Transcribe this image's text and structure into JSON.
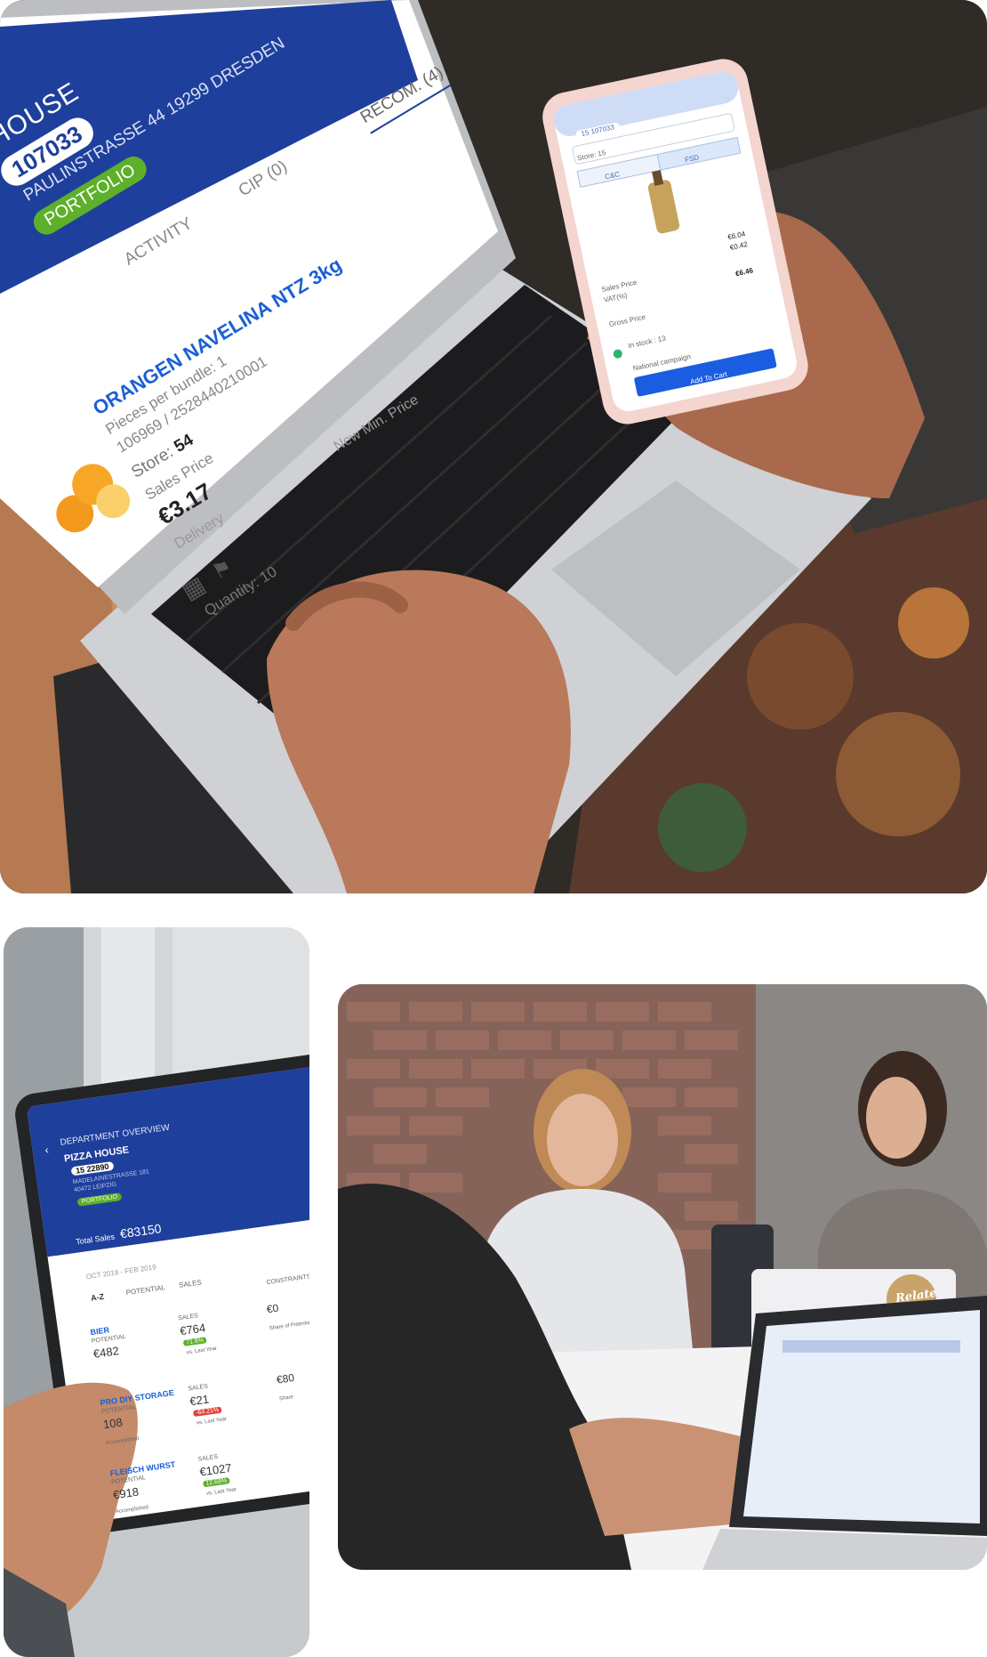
{
  "laptop_screen": {
    "house_name": "HOUSE",
    "store_code": "107033",
    "address": "PAULINSTRASSE 44 19299 DRESDEN",
    "portfolio_badge": "PORTFOLIO",
    "tabs": [
      {
        "label": "ACTIVITY"
      },
      {
        "label": "CIP (0)"
      },
      {
        "label": "RECOM. (4)"
      }
    ],
    "product_name": "ORANGEN NAVELINA NTZ 3kg",
    "pieces_per_bundle": "Pieces per bundle: 1",
    "article_code": "106969 / 2528440210001",
    "store_label": "Store:",
    "store_value": "54",
    "sales_price_label": "Sales Price",
    "sales_price_value": "€3.17",
    "delivery_label": "Delivery",
    "new_min_price_label": "New Min. Price",
    "quantity_label": "Quantity: 10"
  },
  "phone_screen": {
    "header_code": "15 107033",
    "store_select": "Store: 15",
    "toggle_left": "C&C",
    "toggle_right": "FSD",
    "price_main": "€6.04",
    "price_vat": "€0.42",
    "sales_price_label": "Sales Price",
    "vat_label": "VAT(%)",
    "gross_price_label": "Gross Price",
    "gross_price_value": "€6.46",
    "stock_text": "In stock : 13",
    "campaign_text": "National campaign",
    "add_to_cart": "Add To Cart"
  },
  "tablet_screen": {
    "title": "DEPARTMENT OVERVIEW",
    "store_name": "PIZZA HOUSE",
    "store_code": "15 22890",
    "address_line1": "MADELAINESTRASSE 181",
    "address_line2": "40472 LEIPZIG",
    "portfolio_badge": "PORTFOLIO",
    "total_sales_label": "Total Sales",
    "total_sales_value": "€83150",
    "period": "OCT 2018 - FEB 2019",
    "sort_label": "A-Z",
    "col_potential": "POTENTIAL",
    "col_sales": "SALES",
    "col_constraints": "CONSTRAINTS",
    "rows": [
      {
        "name": "BIER",
        "potential_label": "POTENTIAL",
        "potential": "€482",
        "sales_label": "SALES",
        "sales": "€764",
        "badge": "71.8%",
        "vs": "vs. Last Year",
        "constraint": "€0",
        "share": "Share of Potential"
      },
      {
        "name": "PRO DIY STORAGE",
        "potential_label": "POTENTIAL",
        "potential": "108",
        "sales_label": "SALES",
        "sales": "€21",
        "badge": "-64.21%",
        "vs": "vs. Last Year",
        "constraint": "€80",
        "share": "Share",
        "accomplished": "Accomplished"
      },
      {
        "name": "FLEISCH WURST",
        "potential_label": "POTENTIAL",
        "potential": "€918",
        "sales_label": "SALES",
        "sales": "€1027",
        "badge": "12.69%",
        "vs": "vs. Last Year",
        "accomplished": "Accomplished"
      }
    ]
  },
  "meeting_photo": {
    "laptop_sticker": "Relate"
  },
  "colors": {
    "brand_blue": "#1f3f9c",
    "link_blue": "#1a5fd6",
    "badge_green": "#5db02a",
    "badge_red": "#e0413a",
    "phone_header": "#cfdcf5"
  }
}
